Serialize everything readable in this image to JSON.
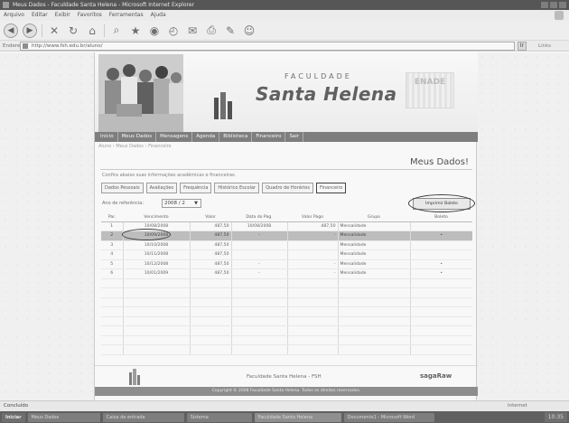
{
  "browser": {
    "title": "Meus Dados - Faculdade Santa Helena - Microsoft Internet Explorer",
    "menu": [
      "Arquivo",
      "Editar",
      "Exibir",
      "Favoritos",
      "Ferramentas",
      "Ajuda"
    ],
    "address_label": "Endereço",
    "address": "http://www.fsh.edu.br/aluno/",
    "go_label": "Ir",
    "links_label": "Links",
    "status": "Concluído",
    "zone": "Internet"
  },
  "site": {
    "logo_pre": "FACULDADE",
    "logo_main": "Santa Helena",
    "badge": "ENADE",
    "nav": [
      "Início",
      "Meus Dados",
      "Mensagens",
      "Agenda",
      "Biblioteca",
      "Financeiro",
      "Sair"
    ],
    "breadcrumb": "Aluno › Meus Dados › Financeiro",
    "page_title": "Meus Dados!",
    "info_text": "Confira abaixo suas informações acadêmicas e financeiras.",
    "tabs": [
      "Dados Pessoais",
      "Avaliações",
      "Frequência",
      "Histórico Escolar",
      "Quadro de Horários",
      "Financeiro"
    ],
    "filter_label": "Ano de referência:",
    "filter_value": "2008 / 2",
    "print_button": "Imprimir Boleto",
    "table": {
      "headers": [
        "Par.",
        "Vencimento",
        "Valor",
        "Data do Pag.",
        "Valor Pago",
        "Grupo",
        "Boleto"
      ],
      "rows": [
        [
          "1",
          "10/08/2008",
          "487,50",
          "10/08/2008",
          "487,50",
          "Mensalidade",
          ""
        ],
        [
          "2",
          "10/09/2008",
          "487,50",
          "-",
          "-",
          "Mensalidade",
          "•"
        ],
        [
          "3",
          "10/10/2008",
          "487,50",
          "",
          "",
          "Mensalidade",
          ""
        ],
        [
          "4",
          "10/11/2008",
          "487,50",
          "",
          "",
          "Mensalidade",
          ""
        ],
        [
          "5",
          "10/12/2008",
          "487,50",
          "-",
          "-",
          "Mensalidade",
          "•"
        ],
        [
          "6",
          "10/01/2009",
          "487,50",
          "-",
          "-",
          "Mensalidade",
          "•"
        ]
      ]
    },
    "footer_text": "Faculdade Santa Helena - FSH",
    "footer_logo": "sagaRaw",
    "copyright": "Copyright © 2008 Faculdade Santa Helena. Todos os direitos reservados."
  },
  "taskbar": {
    "start": "Iniciar",
    "items": [
      "Meus Dados",
      "Caixa de entrada",
      "Sistema",
      "Faculdade Santa Helena",
      "Documento1 - Microsoft Word"
    ],
    "active_index": 3,
    "clock": "10:35"
  }
}
